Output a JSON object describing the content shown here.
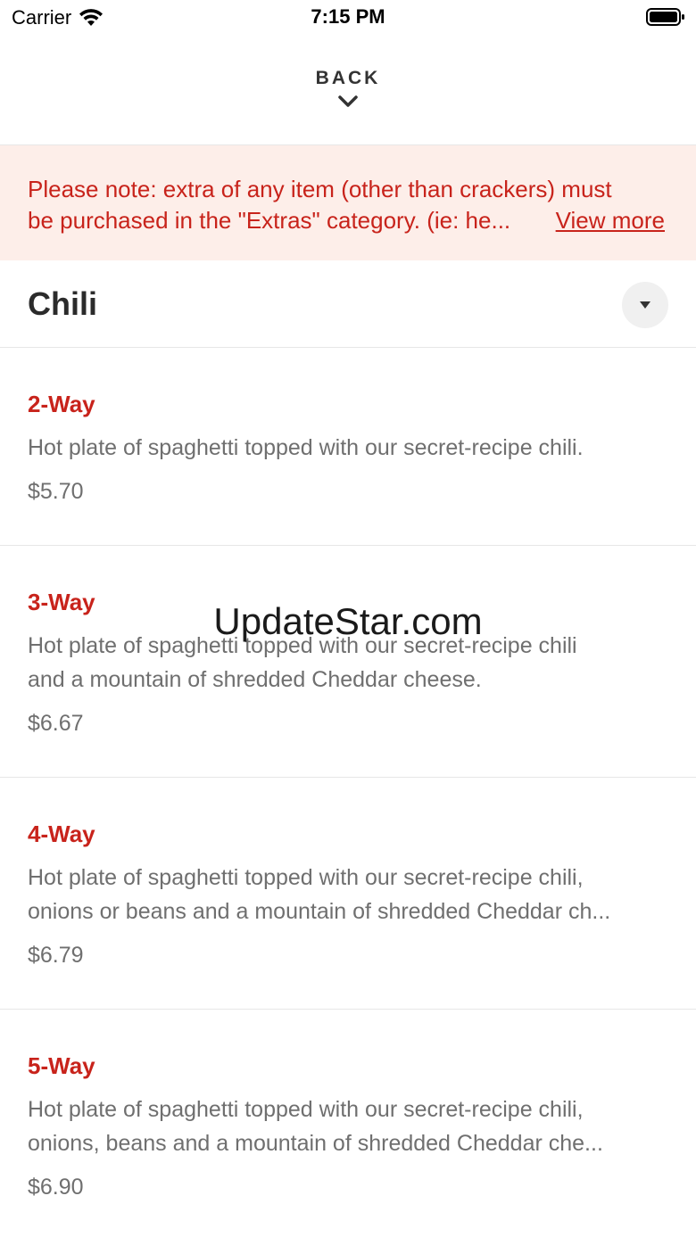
{
  "status_bar": {
    "carrier": "Carrier",
    "time": "7:15 PM",
    "icons": [
      "wifi-icon",
      "battery-icon"
    ]
  },
  "header": {
    "back_label": "BACK",
    "back_icon": "chevron-down-icon"
  },
  "notice": {
    "line1": "Please note: extra of any item (other than crackers) must",
    "line2": "be purchased in the \"Extras\" category. (ie: he...",
    "view_more": "View more"
  },
  "category": {
    "title": "Chili",
    "toggle_icon": "caret-down-icon"
  },
  "items": [
    {
      "name": "2-Way",
      "description_lines": [
        "Hot plate of spaghetti topped with our secret-recipe chili."
      ],
      "price": "$5.70"
    },
    {
      "name": "3-Way",
      "description_lines": [
        "Hot plate of spaghetti topped with our secret-recipe chili",
        "and a mountain of shredded Cheddar cheese."
      ],
      "price": "$6.67"
    },
    {
      "name": "4-Way",
      "description_lines": [
        "Hot plate of spaghetti topped with our secret-recipe chili,",
        "onions or beans and a mountain of shredded Cheddar ch..."
      ],
      "price": "$6.79"
    },
    {
      "name": "5-Way",
      "description_lines": [
        "Hot plate of spaghetti topped with our secret-recipe chili,",
        "onions, beans and a mountain of shredded Cheddar che..."
      ],
      "price": "$6.90"
    }
  ],
  "watermark": "UpdateStar.com",
  "colors": {
    "accent": "#c8231b",
    "notice_bg": "#fdeee9",
    "text_dark": "#2b2b2b",
    "text_muted": "#6f6f6f",
    "divider": "#e7e7e7"
  }
}
